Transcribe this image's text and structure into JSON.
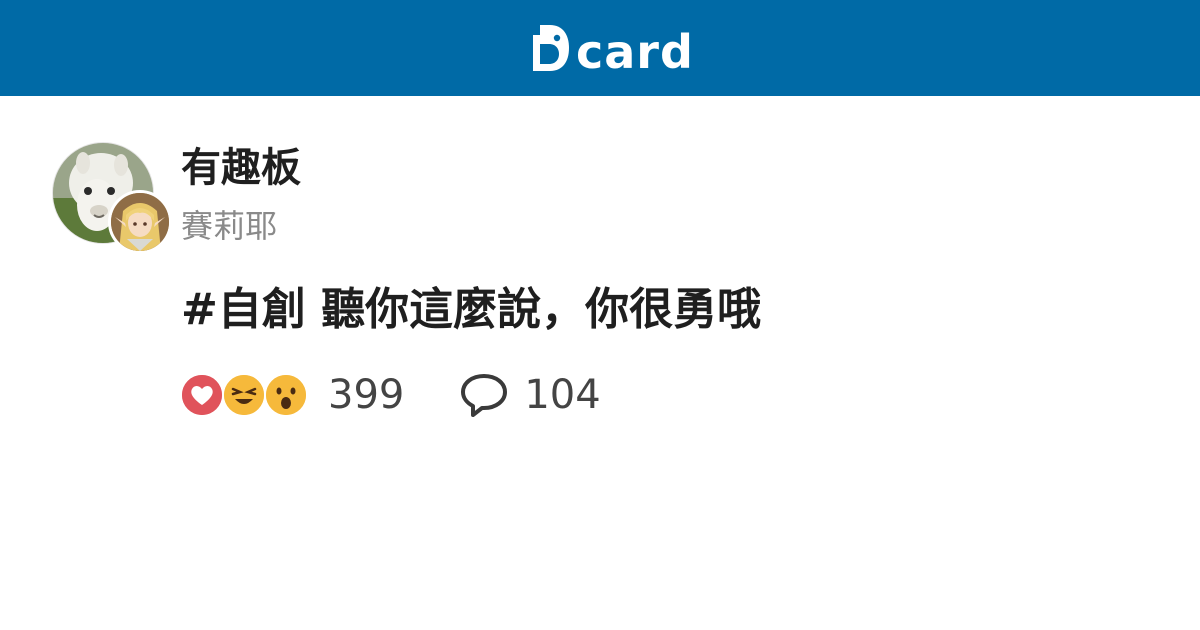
{
  "header": {
    "brand": "card",
    "brand_color": "#006aa6"
  },
  "post": {
    "forum": "有趣板",
    "author": "賽莉耶",
    "title": "#自創 聽你這麼說，你很勇哦",
    "reactions": [
      "heart-icon",
      "laughing-emoji-icon",
      "surprised-emoji-icon"
    ],
    "reaction_count": "399",
    "comment_count": "104"
  },
  "colors": {
    "accent": "#006aa6",
    "heart": "#e0535b",
    "emoji": "#f6b93b",
    "title_text": "#1f1f1f",
    "muted_text": "#8a8a8a"
  }
}
